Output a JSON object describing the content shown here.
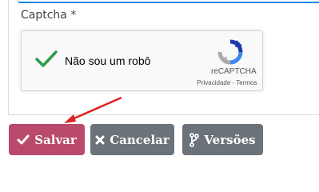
{
  "form": {
    "captcha_label": "Captcha *"
  },
  "recaptcha": {
    "checkbox_text": "Não sou um robô",
    "brand": "reCAPTCHA",
    "links": "Privacidade - Termos",
    "checked": true
  },
  "actions": {
    "save_label": "Salvar",
    "cancel_label": "Cancelar",
    "versions_label": "Versões"
  },
  "icons": {
    "checkmark": "check-icon",
    "save": "check-icon",
    "cancel": "x-icon",
    "versions": "branch-icon",
    "recaptcha": "recaptcha-logo-icon",
    "annotation": "red-arrow"
  },
  "colors": {
    "save_button": "#b94a6b",
    "secondary_button": "#6b7279",
    "check_green": "#2e9c4a",
    "annotation_arrow": "#e02020",
    "input_focus_line": "#1e88e5"
  }
}
